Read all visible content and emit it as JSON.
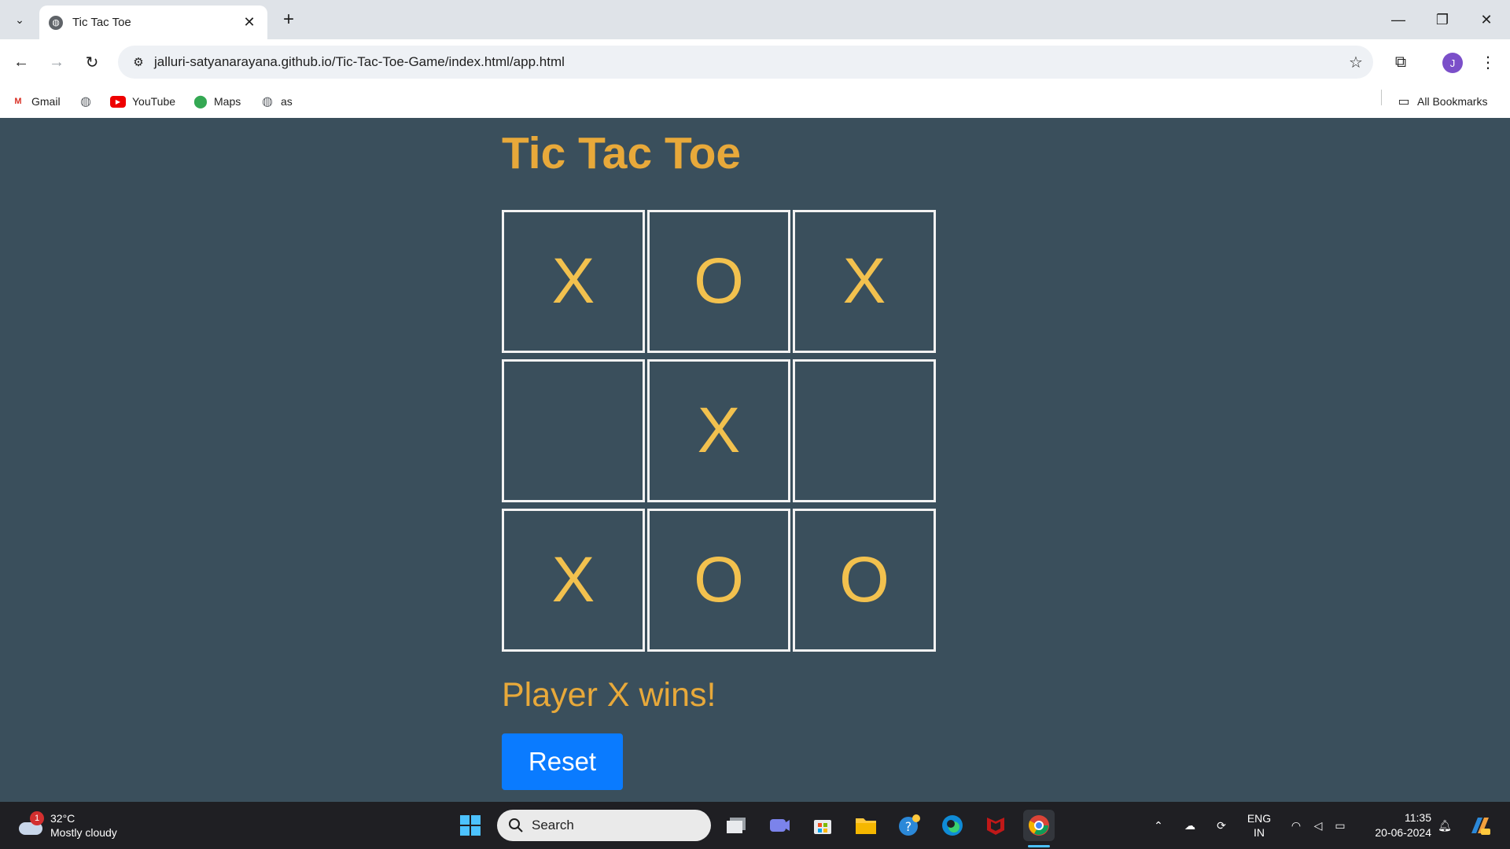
{
  "browser": {
    "tab_title": "Tic Tac Toe",
    "url": "jalluri-satyanarayana.github.io/Tic-Tac-Toe-Game/index.html/app.html",
    "profile_initial": "J",
    "bookmarks": [
      {
        "label": "Gmail",
        "icon": "gmail-icon"
      },
      {
        "label": "",
        "icon": "globe-icon"
      },
      {
        "label": "YouTube",
        "icon": "youtube-icon"
      },
      {
        "label": "Maps",
        "icon": "maps-icon"
      },
      {
        "label": "as",
        "icon": "globe-icon"
      }
    ],
    "all_bookmarks_label": "All Bookmarks"
  },
  "game": {
    "title": "Tic Tac Toe",
    "board": [
      "X",
      "O",
      "X",
      "",
      "X",
      "",
      "X",
      "O",
      "O"
    ],
    "status": "Player X wins!",
    "reset_label": "Reset"
  },
  "taskbar": {
    "weather_temp": "32°C",
    "weather_desc": "Mostly cloudy",
    "weather_badge": "1",
    "search_label": "Search",
    "language_line1": "ENG",
    "language_line2": "IN",
    "time": "11:35",
    "date": "20-06-2024"
  },
  "colors": {
    "page_bg": "#3a4f5c",
    "accent_text": "#e8a93a",
    "mark_color": "#f2c14e",
    "reset_button": "#0a7bff"
  }
}
